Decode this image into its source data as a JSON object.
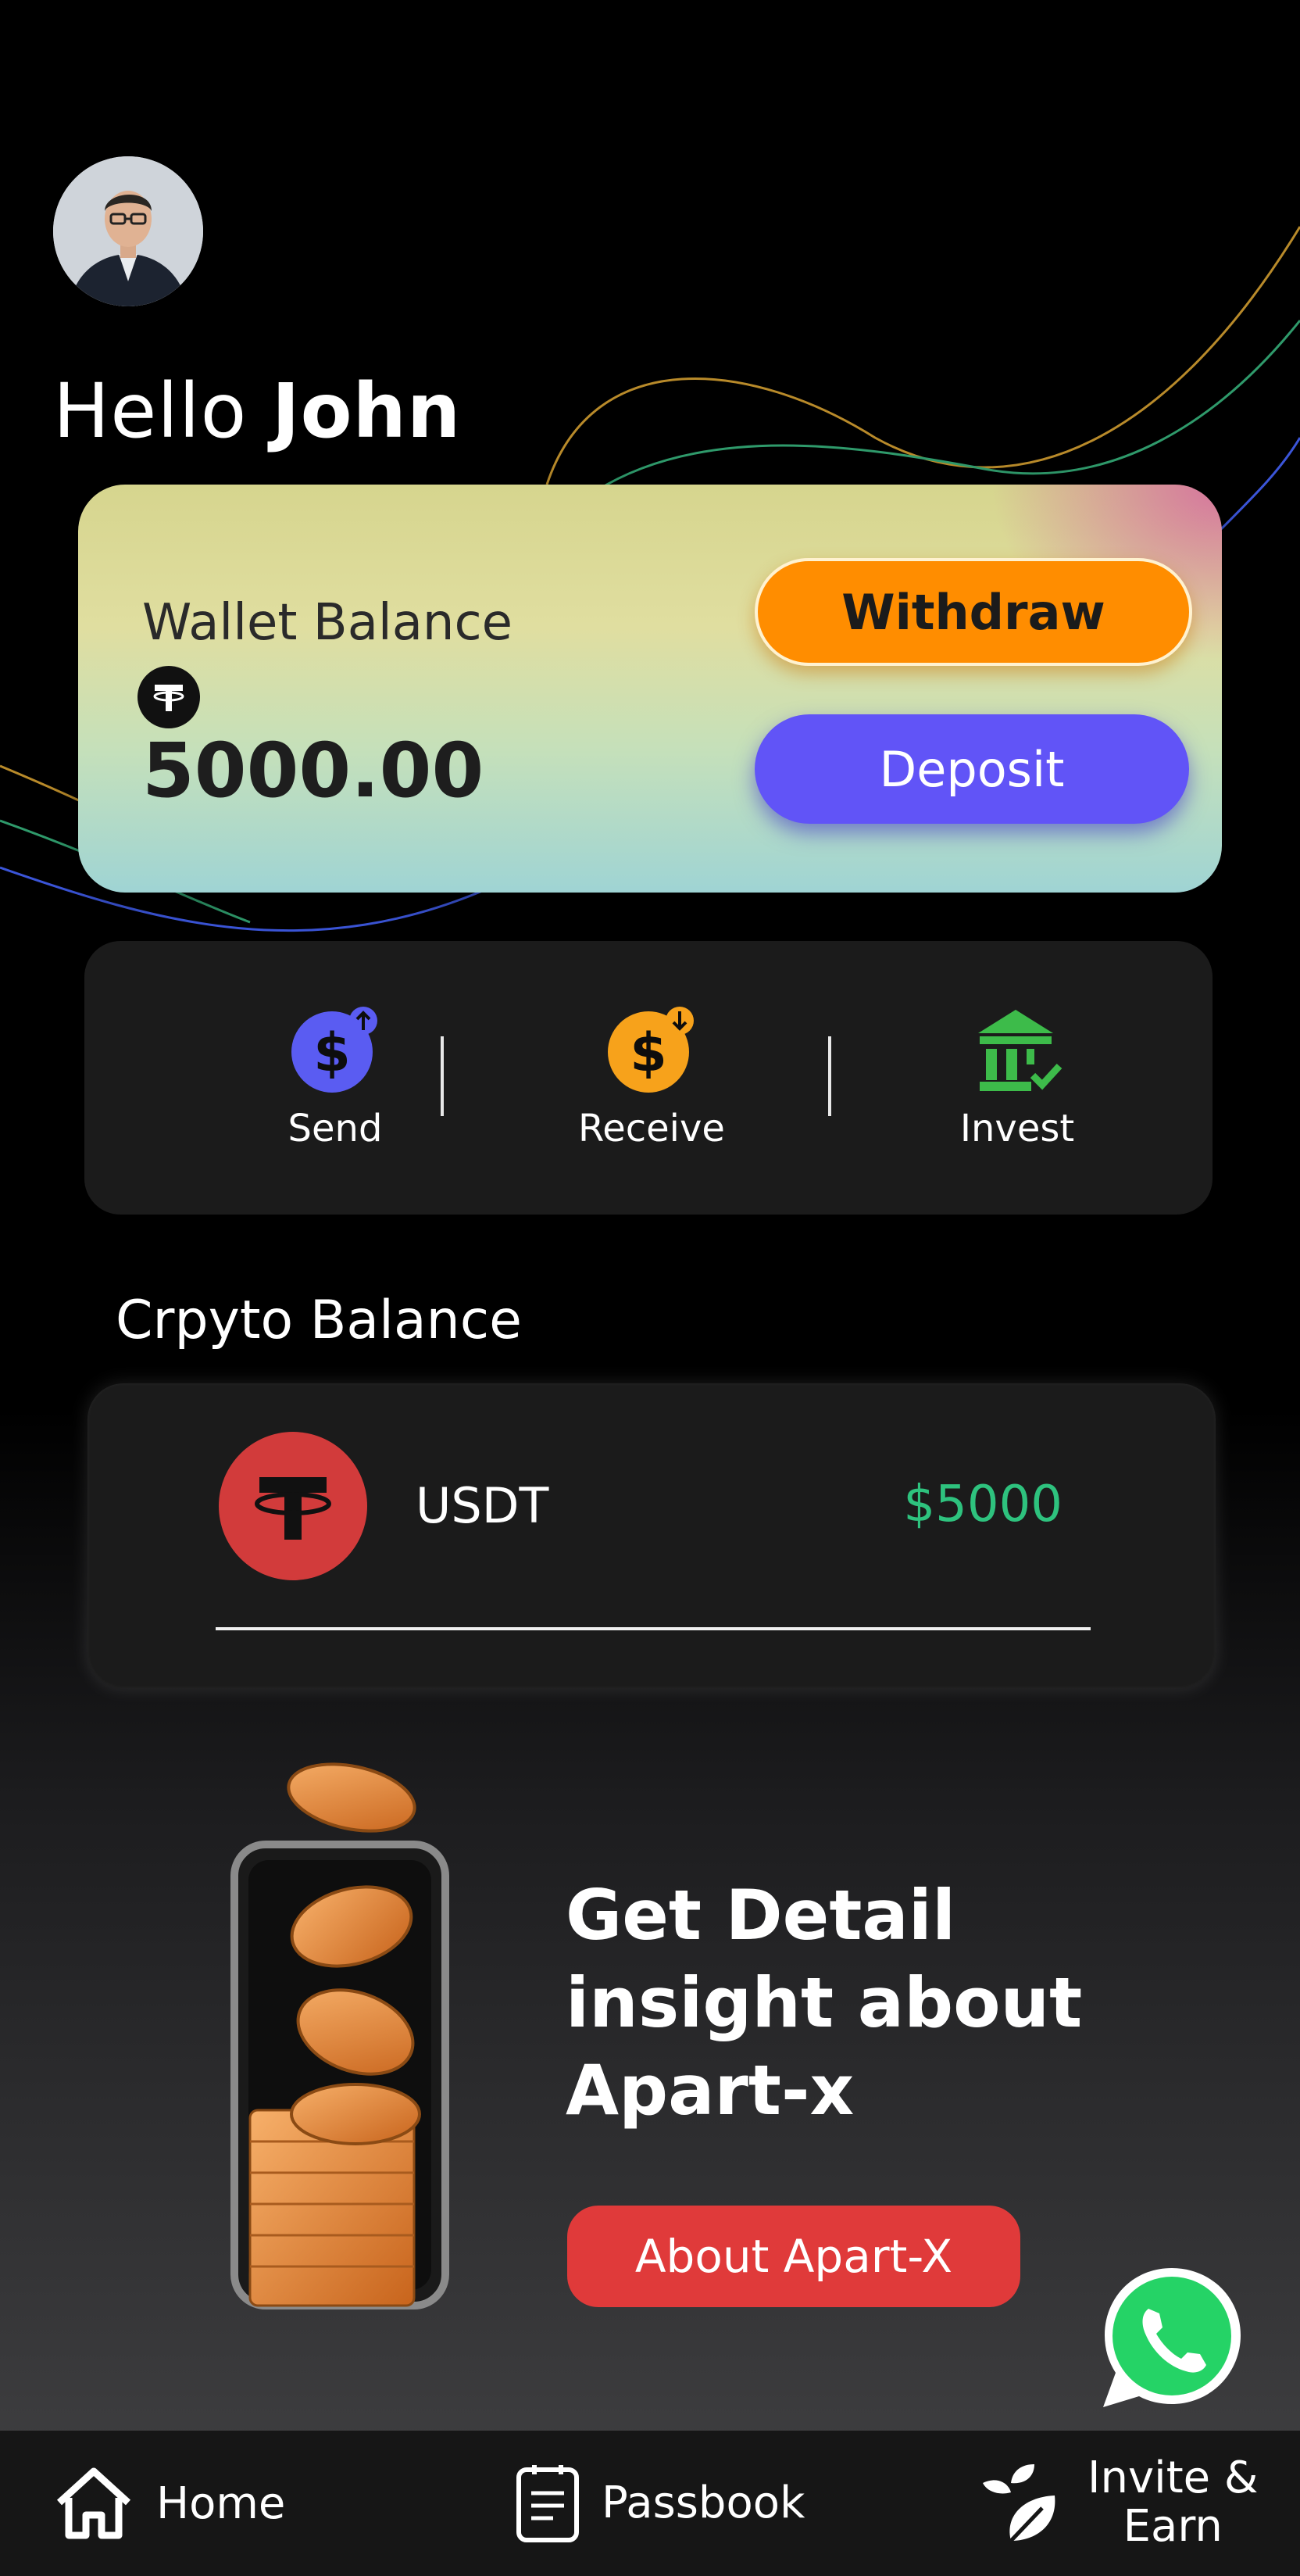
{
  "user": {
    "greeting_prefix": "Hello",
    "name": "John"
  },
  "wallet": {
    "label": "Wallet Balance",
    "amount": "5000.00",
    "withdraw_label": "Withdraw",
    "deposit_label": "Deposit"
  },
  "actions": [
    {
      "label": "Send",
      "icon": "dollar-send-icon",
      "color": "#5a5cf2"
    },
    {
      "label": "Receive",
      "icon": "dollar-receive-icon",
      "color": "#f7a21b"
    },
    {
      "label": "Invest",
      "icon": "bank-check-icon",
      "color": "#3dbb4a"
    }
  ],
  "crypto": {
    "title": "Crpyto Balance",
    "items": [
      {
        "symbol": "USDT",
        "value": "$5000",
        "icon": "tether-icon"
      }
    ]
  },
  "promo": {
    "line1": "Get Detail",
    "line2": "insight about",
    "line3": "Apart-x",
    "button_label": "About Apart-X"
  },
  "nav": {
    "home": "Home",
    "passbook": "Passbook",
    "invite_line1": "Invite &",
    "invite_line2": "Earn"
  },
  "colors": {
    "withdraw": "#ff8d00",
    "deposit": "#6154f7",
    "positive_value": "#2ec27e",
    "about_button": "#e03a3a",
    "whatsapp": "#25d366"
  }
}
